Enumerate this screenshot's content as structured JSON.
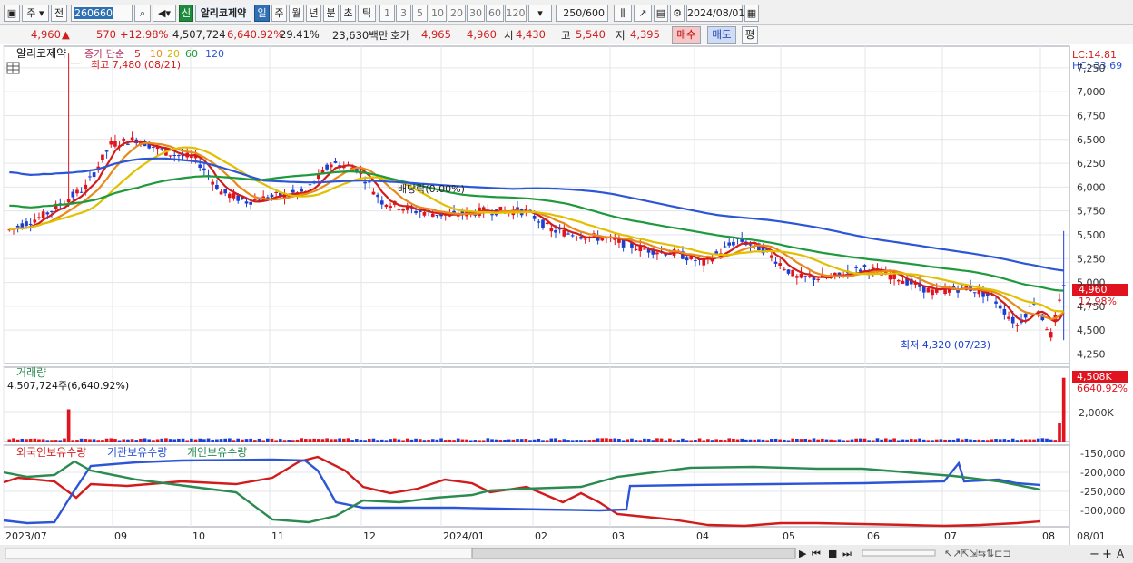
{
  "toolbar": {
    "market": "주",
    "type_label": "전",
    "code": "260660",
    "new_label": "신",
    "stock_name": "알리코제약",
    "periods": [
      "일",
      "주",
      "월",
      "년",
      "분",
      "초",
      "틱"
    ],
    "active_period": "일",
    "intervals": [
      "1",
      "3",
      "5",
      "10",
      "20",
      "30",
      "60",
      "120"
    ],
    "count": "250",
    "count_total": "/600",
    "date": "2024/08/01"
  },
  "info": {
    "price": "4,960",
    "arrow": "▲",
    "change": "570",
    "change_pct": "+12.98%",
    "volume": "4,507,724",
    "volume_pct": "6,640.92%",
    "turnover_pct": "29.41%",
    "amount": "23,630백만",
    "ask_label": "호가",
    "ask_value": "4,965",
    "bid_value": "4,960",
    "open_label": "시",
    "open_value": "4,430",
    "high_label": "고",
    "high_value": "5,540",
    "low_label": "저",
    "low_value": "4,395",
    "buy_label": "매수",
    "sell_label": "매도",
    "eval_label": "평"
  },
  "price_panel": {
    "title": "알리코제약",
    "ma_label": "종가 단순",
    "ma_periods": [
      "5",
      "10",
      "20",
      "60",
      "120"
    ],
    "ma_colors": [
      "#d21c1c",
      "#e88a1a",
      "#e0c000",
      "#1e9a3c",
      "#2d56d6"
    ],
    "high_note": "최고 7,480 (08/21)",
    "low_note": "최저 4,320 (07/23)",
    "dividend_note": "배당락(0.00%)",
    "lc": "LC:14.81",
    "hc": "HC:-33.69",
    "current_price_tag": "4,960",
    "current_pct_tag": "12.98%",
    "y_ticks": [
      "7,250",
      "7,000",
      "6,750",
      "6,500",
      "6,250",
      "6,000",
      "5,750",
      "5,500",
      "5,250",
      "5,000",
      "4,750",
      "4,500",
      "4,250"
    ]
  },
  "volume_panel": {
    "title": "거래량",
    "value_note": "4,507,724주(6,640.92%)",
    "tag_value": "4,508K",
    "tag_pct": "6640.92%",
    "y_ticks": [
      "2,000K"
    ]
  },
  "holdings_panel": {
    "legend": [
      "외국인보유수량",
      "기관보유수량",
      "개인보유수량"
    ],
    "legend_colors": [
      "#d21c1c",
      "#2d56d6",
      "#2a8a50"
    ],
    "y_ticks": [
      "-150,000",
      "-200,000",
      "-250,000",
      "-300,000"
    ]
  },
  "x_axis": {
    "labels": [
      "2023/07",
      "09",
      "10",
      "11",
      "12",
      "2024/01",
      "02",
      "03",
      "04",
      "05",
      "06",
      "07",
      "08"
    ],
    "right_label": "08/01"
  }
}
